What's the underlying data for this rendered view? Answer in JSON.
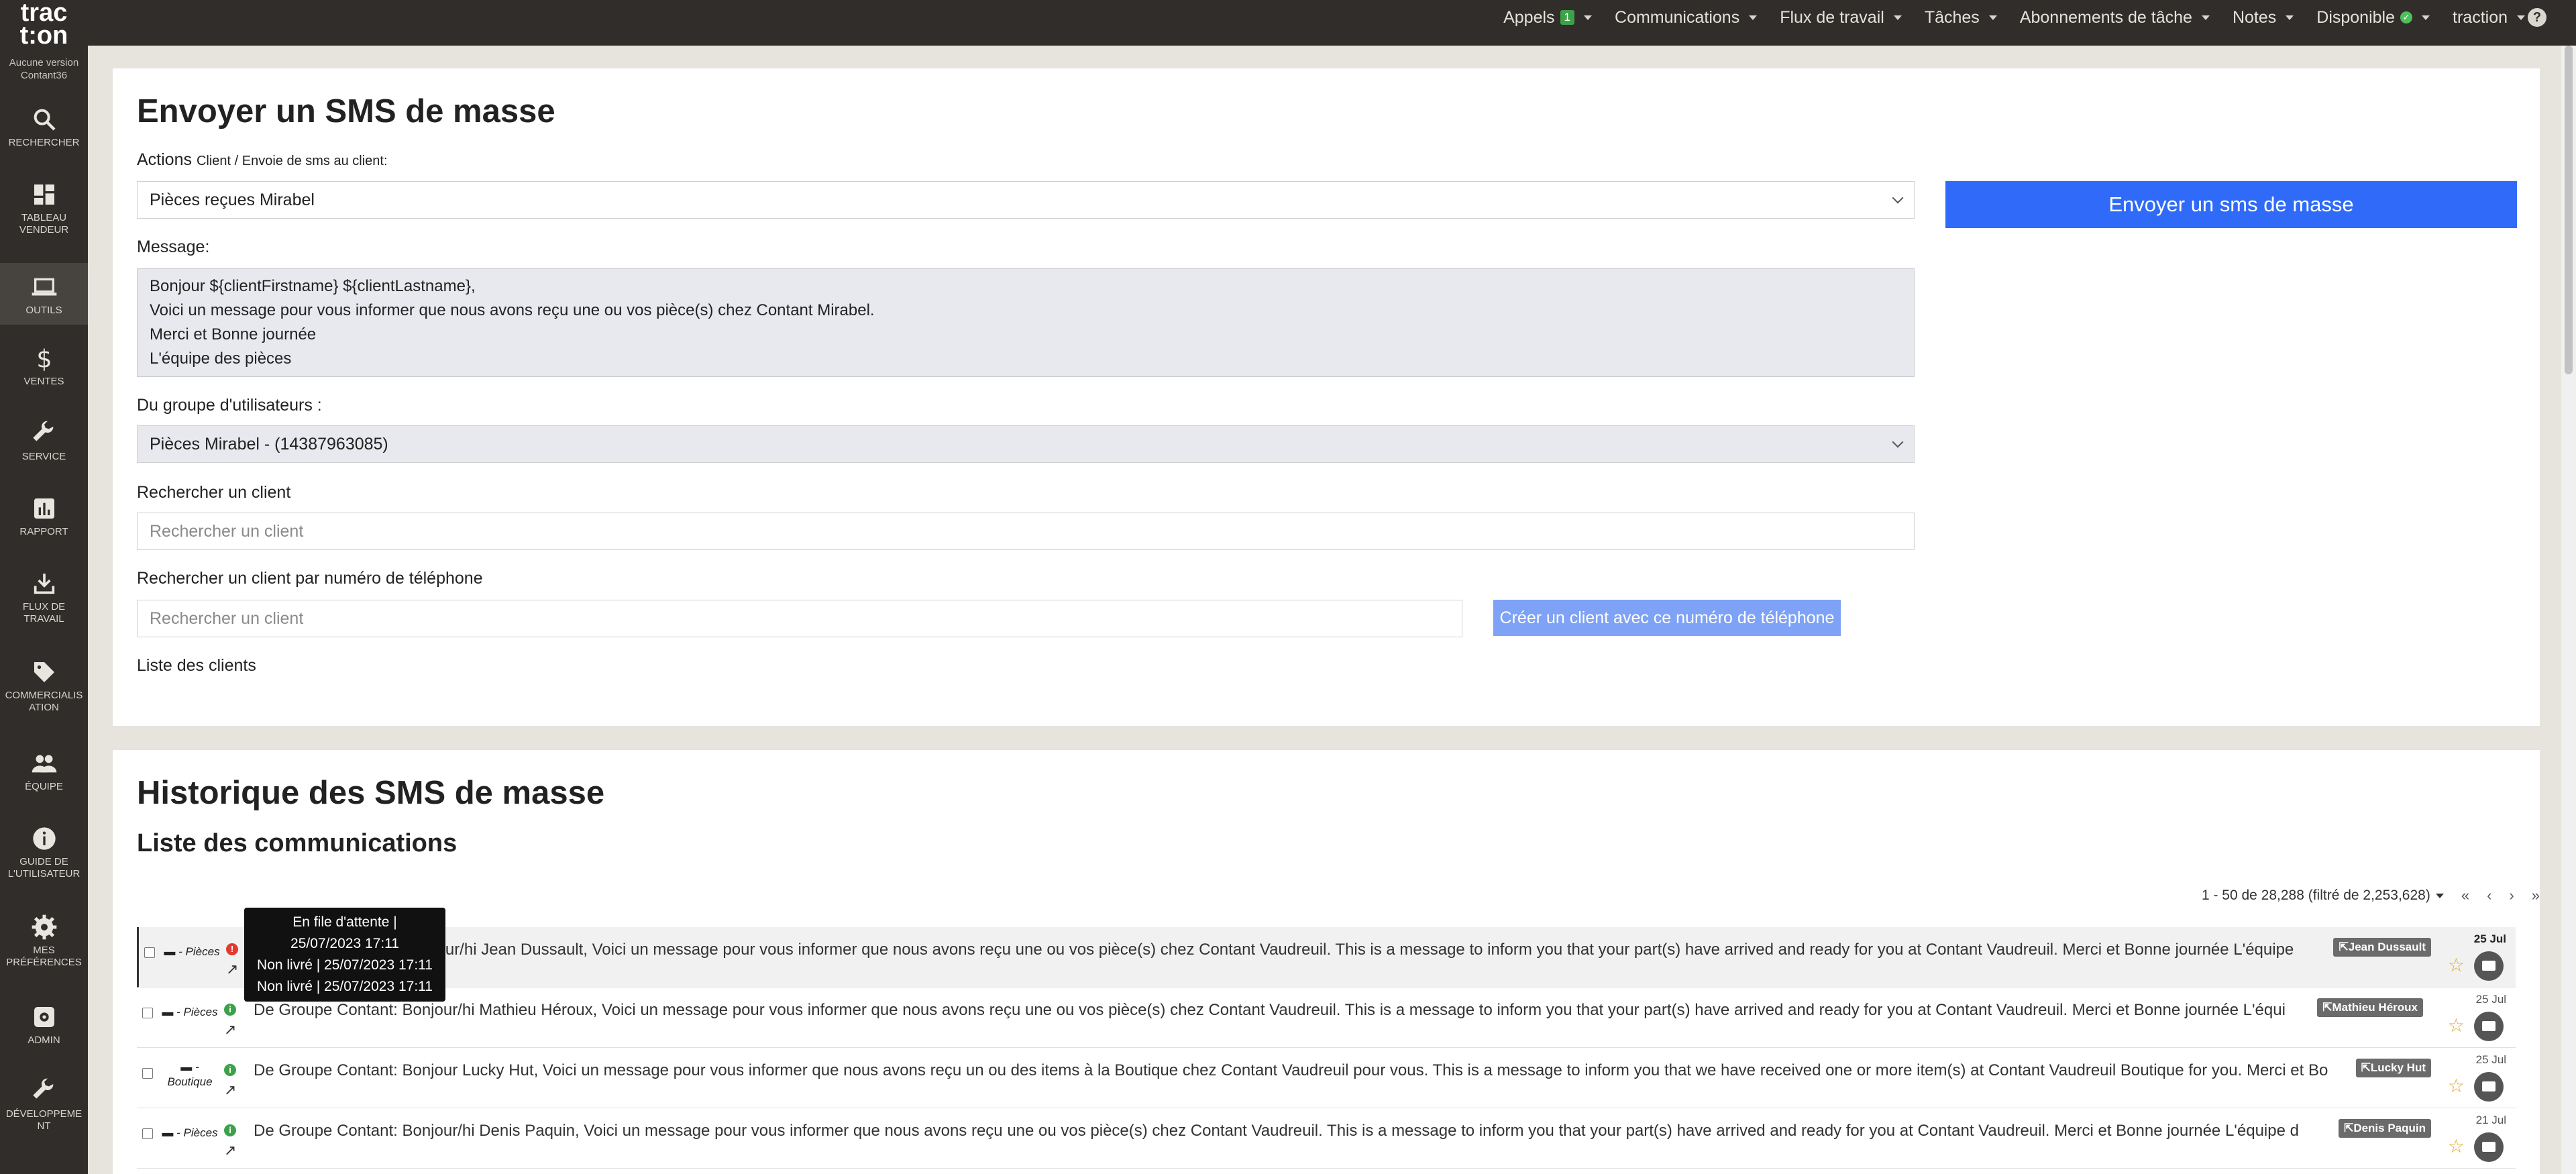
{
  "topnav": {
    "items": [
      {
        "label": "Appels",
        "badge": "1"
      },
      {
        "label": "Communications"
      },
      {
        "label": "Flux de travail"
      },
      {
        "label": "Tâches"
      },
      {
        "label": "Abonnements de tâche"
      },
      {
        "label": "Notes"
      },
      {
        "label": "Disponible"
      },
      {
        "label": "traction"
      }
    ],
    "help_label": "?"
  },
  "sidebar": {
    "logo": "trac\nt:on",
    "version": "Aucune version\nContant36",
    "items": [
      {
        "label": "RECHERCHER",
        "icon": "search-icon"
      },
      {
        "label": "TABLEAU\nVENDEUR",
        "icon": "dashboard-icon"
      },
      {
        "label": "OUTILS",
        "icon": "laptop-icon"
      },
      {
        "label": "VENTES",
        "icon": "dollar-icon"
      },
      {
        "label": "SERVICE",
        "icon": "wrench-icon"
      },
      {
        "label": "RAPPORT",
        "icon": "report-icon"
      },
      {
        "label": "FLUX DE\nTRAVAIL",
        "icon": "download-icon"
      },
      {
        "label": "COMMERCIALIS\nATION",
        "icon": "tag-icon"
      },
      {
        "label": "ÉQUIPE",
        "icon": "team-icon"
      },
      {
        "label": "GUIDE DE\nL'UTILISATEUR",
        "icon": "info-icon"
      },
      {
        "label": "MES\nPRÉFÉRENCES",
        "icon": "gear-icon"
      },
      {
        "label": "ADMIN",
        "icon": "admin-icon"
      },
      {
        "label": "DÉVELOPPEME\nNT",
        "icon": "wrench-icon"
      }
    ]
  },
  "form": {
    "title": "Envoyer un SMS de masse",
    "actions_label": "Actions",
    "actions_sub": "Client / Envoie de sms au client:",
    "actions_value": "Pièces reçues Mirabel",
    "message_label": "Message:",
    "message_value": "Bonjour ${clientFirstname} ${clientLastname},\nVoici un message pour vous informer que nous avons reçu une ou vos pièce(s) chez Contant Mirabel.\nMerci et Bonne journée\nL'équipe des pièces",
    "group_label": "Du groupe d'utilisateurs :",
    "group_value": "Pièces Mirabel - (14387963085)",
    "search_client_label": "Rechercher un client",
    "search_client_placeholder": "Rechercher un client",
    "search_phone_label": "Rechercher un client par numéro de téléphone",
    "search_phone_placeholder": "Rechercher un client",
    "create_client_button": "Créer un client avec ce numéro de téléphone",
    "client_list_label": "Liste des clients",
    "send_button": "Envoyer un sms de masse"
  },
  "history": {
    "title": "Historique des SMS de masse",
    "subtitle": "Liste des communications",
    "pagination": "1 - 50 de 28,288 (filtré de 2,253,628)",
    "pager_first": "«",
    "pager_prev": "‹",
    "pager_next": "›",
    "pager_last": "»",
    "tooltip": [
      "En file d'attente |",
      "25/07/2023 17:11",
      "Non livré | 25/07/2023 17:11",
      "Non livré | 25/07/2023 17:11"
    ],
    "rows": [
      {
        "type": "- Pièces",
        "status": "error",
        "message": "De Groupe Contant: Bonjour/hi  Jean Dussault, Voici un message pour vous informer que nous avons reçu une ou vos pièce(s) chez Contant Vaudreuil. This is a message to inform you that your part(s) have arrived and ready for you at Contant Vaudreuil.  Merci et Bonne journée L'équipe",
        "contact": "Jean Dussault",
        "date": "25 Jul",
        "bold": true
      },
      {
        "type": "- Pièces",
        "status": "ok",
        "message": "De Groupe Contant: Bonjour/hi  Mathieu Héroux, Voici un message pour vous informer que nous avons reçu une ou vos pièce(s) chez Contant Vaudreuil. This is a message to inform you that your part(s) have arrived and ready for you at Contant Vaudreuil.  Merci et Bonne journée L'équi",
        "contact": "Mathieu Héroux",
        "date": "25 Jul",
        "bold": false
      },
      {
        "type": "-\nBoutique",
        "status": "ok",
        "message": "De Groupe Contant: Bonjour Lucky Hut, Voici un message pour vous informer que nous avons reçu un ou des items à la Boutique chez Contant Vaudreuil pour vous. This is a message to inform you that we have received one or more item(s) at Contant Vaudreuil Boutique for you. Merci et Bo",
        "contact": "Lucky Hut",
        "date": "25 Jul",
        "bold": false
      },
      {
        "type": "- Pièces",
        "status": "ok",
        "message": "De Groupe Contant: Bonjour/hi  Denis Paquin, Voici un message pour vous informer que nous avons reçu une ou vos pièce(s) chez Contant Vaudreuil. This is a message to inform you that your part(s) have arrived and ready for you at Contant Vaudreuil.  Merci et Bonne journée L'équipe d",
        "contact": "Denis Paquin",
        "date": "21 Jul",
        "bold": false
      }
    ]
  },
  "colors": {
    "accent": "#2f6bf8",
    "dark": "#302d2a",
    "ok": "#3ca24a",
    "error": "#e03b2f"
  }
}
